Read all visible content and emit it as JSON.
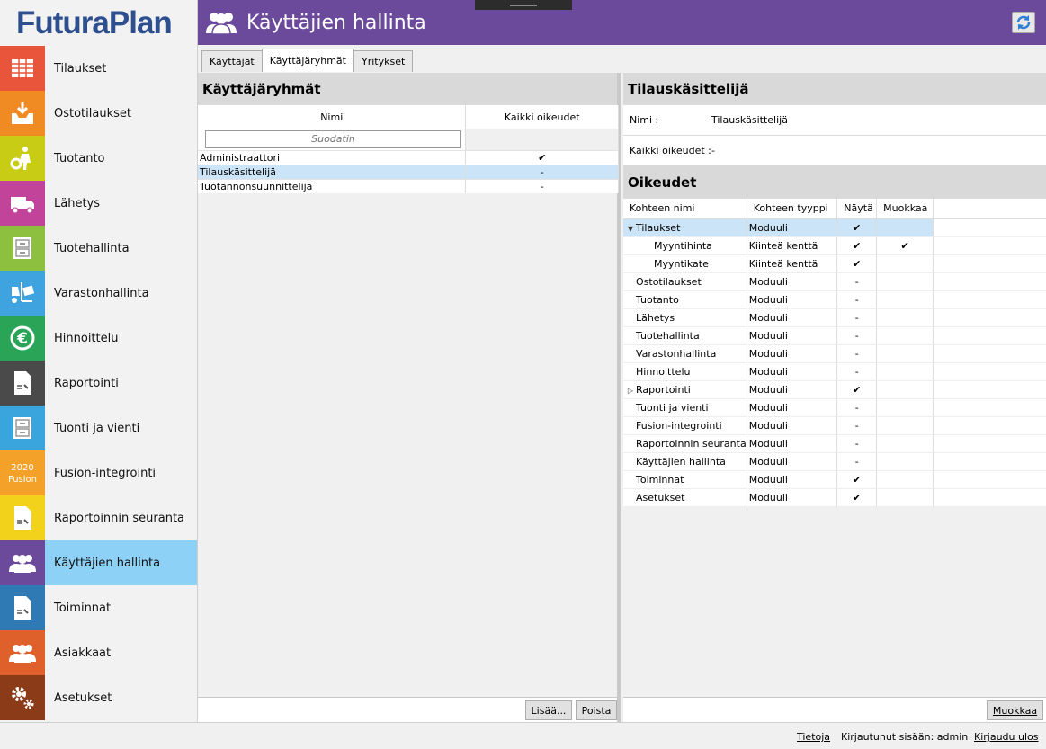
{
  "app": {
    "logo": "FuturaPlan"
  },
  "header": {
    "title": "Käyttäjien hallinta"
  },
  "sidebar": {
    "items": [
      {
        "label": "Tilaukset",
        "color": "#e8553a",
        "icon": "table-icon"
      },
      {
        "label": "Ostotilaukset",
        "color": "#ef8b22",
        "icon": "inbox-icon"
      },
      {
        "label": "Tuotanto",
        "color": "#c9cc14",
        "icon": "worker-gear-icon"
      },
      {
        "label": "Lähetys",
        "color": "#c1449a",
        "icon": "truck-icon"
      },
      {
        "label": "Tuotehallinta",
        "color": "#8dc03f",
        "icon": "cabinet-icon"
      },
      {
        "label": "Varastonhallinta",
        "color": "#3fa3e0",
        "icon": "forklift-icon"
      },
      {
        "label": "Hinnoittelu",
        "color": "#2aa456",
        "icon": "euro-icon"
      },
      {
        "label": "Raportointi",
        "color": "#4a4a4a",
        "icon": "report-icon"
      },
      {
        "label": "Tuonti ja vienti",
        "color": "#3aa5dc",
        "icon": "cabinet-icon"
      },
      {
        "label": "Fusion-integrointi",
        "color": "#f4a12a",
        "icon": "fusion-logo-icon",
        "icon_text": "2020 Fusion"
      },
      {
        "label": "Raportoinnin seuranta",
        "color": "#f3d21b",
        "icon": "report-icon"
      },
      {
        "label": "Käyttäjien hallinta",
        "color": "#6b4a9c",
        "icon": "users-icon",
        "active": true
      },
      {
        "label": "Toiminnat",
        "color": "#2f7ab5",
        "icon": "report-icon"
      },
      {
        "label": "Asiakkaat",
        "color": "#e0602c",
        "icon": "users-icon"
      },
      {
        "label": "Asetukset",
        "color": "#8b3b18",
        "icon": "gears-icon"
      }
    ]
  },
  "tabs": [
    {
      "label": "Käyttäjät",
      "active": false
    },
    {
      "label": "Käyttäjäryhmät",
      "active": true
    },
    {
      "label": "Yritykset",
      "active": false
    }
  ],
  "groups": {
    "title": "Käyttäjäryhmät",
    "col_name": "Nimi",
    "col_all": "Kaikki oikeudet",
    "filter_placeholder": "Suodatin",
    "rows": [
      {
        "name": "Administraattori",
        "all": "✔",
        "selected": false
      },
      {
        "name": "Tilauskäsittelijä",
        "all": "-",
        "selected": true
      },
      {
        "name": "Tuotannonsuunnittelija",
        "all": "-",
        "selected": false
      }
    ],
    "add_button": "Lisää...",
    "remove_button": "Poista"
  },
  "detail": {
    "title": "Tilauskäsittelijä",
    "name_label": "Nimi :",
    "name_value": "Tilauskäsittelijä",
    "all_label": "Kaikki oikeudet :",
    "all_value": "-"
  },
  "permissions": {
    "title": "Oikeudet",
    "columns": [
      "Kohteen nimi",
      "Kohteen tyyppi",
      "Näytä",
      "Muokkaa"
    ],
    "rows": [
      {
        "name": "Tilaukset",
        "type": "Moduuli",
        "show": "✔",
        "edit": "",
        "expander": "▼",
        "indent": 0,
        "selected": true
      },
      {
        "name": "Myyntihinta",
        "type": "Kiinteä kenttä",
        "show": "✔",
        "edit": "✔",
        "expander": "",
        "indent": 1,
        "selected": false
      },
      {
        "name": "Myyntikate",
        "type": "Kiinteä kenttä",
        "show": "✔",
        "edit": "",
        "expander": "",
        "indent": 1,
        "selected": false
      },
      {
        "name": "Ostotilaukset",
        "type": "Moduuli",
        "show": "-",
        "edit": "",
        "expander": "",
        "indent": 0,
        "selected": false
      },
      {
        "name": "Tuotanto",
        "type": "Moduuli",
        "show": "-",
        "edit": "",
        "expander": "",
        "indent": 0,
        "selected": false
      },
      {
        "name": "Lähetys",
        "type": "Moduuli",
        "show": "-",
        "edit": "",
        "expander": "",
        "indent": 0,
        "selected": false
      },
      {
        "name": "Tuotehallinta",
        "type": "Moduuli",
        "show": "-",
        "edit": "",
        "expander": "",
        "indent": 0,
        "selected": false
      },
      {
        "name": "Varastonhallinta",
        "type": "Moduuli",
        "show": "-",
        "edit": "",
        "expander": "",
        "indent": 0,
        "selected": false
      },
      {
        "name": "Hinnoittelu",
        "type": "Moduuli",
        "show": "-",
        "edit": "",
        "expander": "",
        "indent": 0,
        "selected": false
      },
      {
        "name": "Raportointi",
        "type": "Moduuli",
        "show": "✔",
        "edit": "",
        "expander": "▷",
        "indent": 0,
        "selected": false
      },
      {
        "name": "Tuonti ja vienti",
        "type": "Moduuli",
        "show": "-",
        "edit": "",
        "expander": "",
        "indent": 0,
        "selected": false
      },
      {
        "name": "Fusion-integrointi",
        "type": "Moduuli",
        "show": "-",
        "edit": "",
        "expander": "",
        "indent": 0,
        "selected": false
      },
      {
        "name": "Raportoinnin seuranta",
        "type": "Moduuli",
        "show": "-",
        "edit": "",
        "expander": "",
        "indent": 0,
        "selected": false
      },
      {
        "name": "Käyttäjien hallinta",
        "type": "Moduuli",
        "show": "-",
        "edit": "",
        "expander": "",
        "indent": 0,
        "selected": false
      },
      {
        "name": "Toiminnat",
        "type": "Moduuli",
        "show": "✔",
        "edit": "",
        "expander": "",
        "indent": 0,
        "selected": false
      },
      {
        "name": "Asetukset",
        "type": "Moduuli",
        "show": "✔",
        "edit": "",
        "expander": "",
        "indent": 0,
        "selected": false
      }
    ],
    "edit_button": "Muokkaa"
  },
  "statusbar": {
    "about_link": "Tietoja",
    "logged_in_text": "Kirjautunut sisään: admin",
    "logout_link": "Kirjaudu ulos"
  },
  "colors": {
    "header": "#6b4a9c",
    "active_nav": "#8ed1f7",
    "selection": "#cce4f7"
  }
}
